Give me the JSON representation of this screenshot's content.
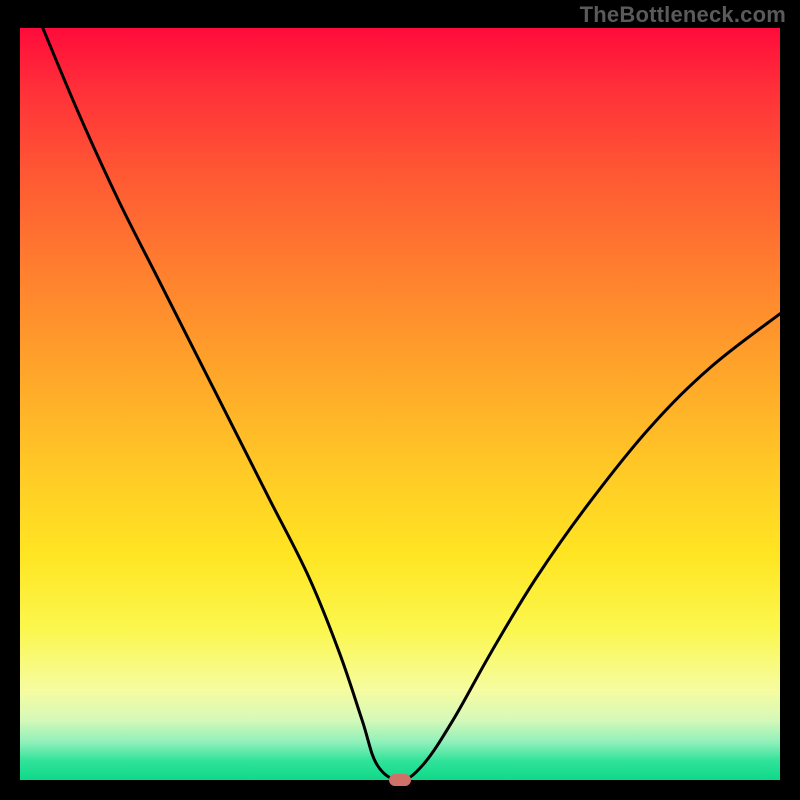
{
  "watermark": "TheBottleneck.com",
  "chart_data": {
    "type": "line",
    "title": "",
    "xlabel": "",
    "ylabel": "",
    "xlim": [
      0,
      1
    ],
    "ylim": [
      0,
      1
    ],
    "series": [
      {
        "name": "bottleneck-curve",
        "x": [
          0.03,
          0.08,
          0.13,
          0.18,
          0.23,
          0.28,
          0.33,
          0.38,
          0.42,
          0.45,
          0.47,
          0.5,
          0.53,
          0.57,
          0.62,
          0.68,
          0.75,
          0.83,
          0.91,
          1.0
        ],
        "values": [
          1.0,
          0.88,
          0.77,
          0.67,
          0.57,
          0.47,
          0.37,
          0.27,
          0.17,
          0.08,
          0.02,
          0.0,
          0.02,
          0.08,
          0.17,
          0.27,
          0.37,
          0.47,
          0.55,
          0.62
        ]
      }
    ],
    "marker": {
      "x": 0.5,
      "y": 0.0
    },
    "gradient_stops": [
      {
        "pos": 0.0,
        "color": "#ff0b3b"
      },
      {
        "pos": 0.5,
        "color": "#ffc726"
      },
      {
        "pos": 0.8,
        "color": "#fbf74e"
      },
      {
        "pos": 1.0,
        "color": "#0fd989"
      }
    ]
  }
}
